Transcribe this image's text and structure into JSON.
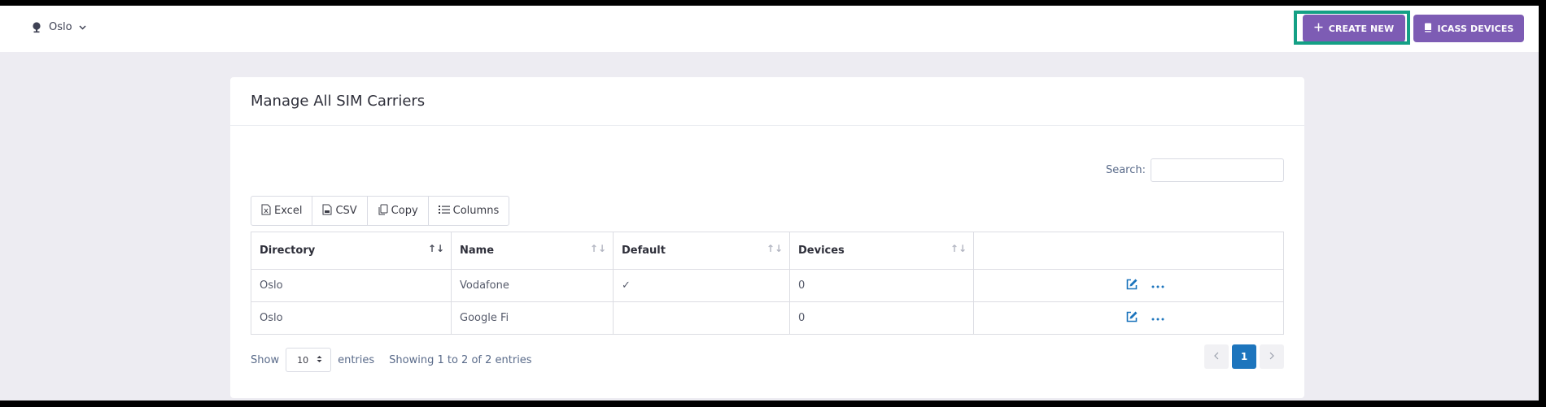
{
  "topbar": {
    "directory": "Oslo",
    "create_label": "CREATE NEW",
    "icass_label": "ICASS DEVICES"
  },
  "card": {
    "title": "Manage All SIM Carriers",
    "search_label": "Search:",
    "search_value": ""
  },
  "toolbar": {
    "excel": "Excel",
    "csv": "CSV",
    "copy": "Copy",
    "columns": "Columns"
  },
  "table": {
    "columns": [
      "Directory",
      "Name",
      "Default",
      "Devices",
      ""
    ],
    "rows": [
      {
        "directory": "Oslo",
        "name": "Vodafone",
        "default": "✓",
        "devices": "0"
      },
      {
        "directory": "Oslo",
        "name": "Google Fi",
        "default": "",
        "devices": "0"
      }
    ]
  },
  "footer": {
    "show": "Show",
    "length": "10",
    "entries": "entries",
    "info": "Showing 1 to 2 of 2 entries",
    "page": "1"
  },
  "colors": {
    "primary_button": "#7d5cb4",
    "focus_ring": "#14a085",
    "page_active": "#1d75bd",
    "action_icon": "#1d75bd"
  }
}
